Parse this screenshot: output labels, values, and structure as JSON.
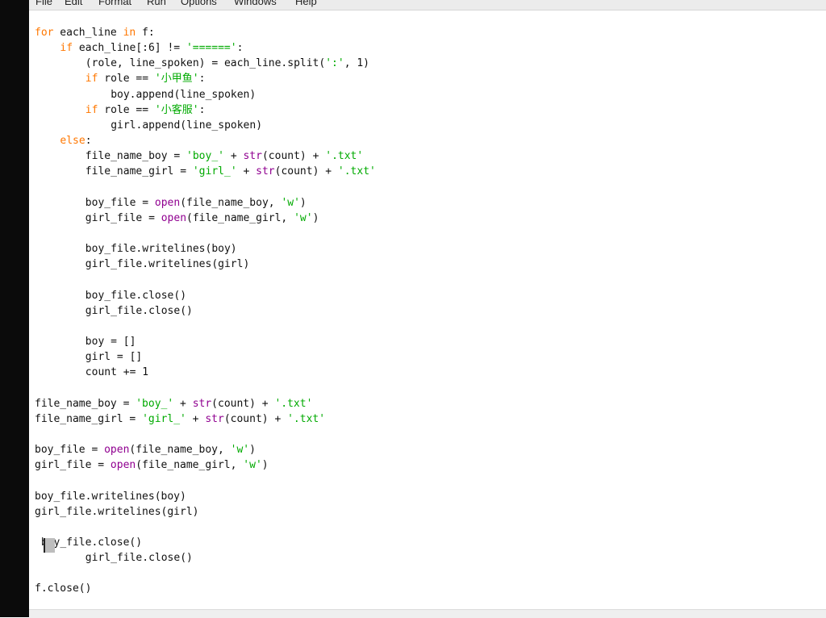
{
  "menubar": {
    "items": [
      "File",
      "Edit",
      "Format",
      "Run",
      "Options",
      "Windows",
      "Help"
    ]
  },
  "editor": {
    "lines": [
      {
        "indent": 0,
        "tokens": [
          {
            "t": "for",
            "c": "kw"
          },
          {
            "t": " each_line "
          },
          {
            "t": "in",
            "c": "kw"
          },
          {
            "t": " f:"
          }
        ]
      },
      {
        "indent": 4,
        "tokens": [
          {
            "t": "if",
            "c": "kw"
          },
          {
            "t": " each_line[:6] != "
          },
          {
            "t": "'======'",
            "c": "str"
          },
          {
            "t": ":"
          }
        ]
      },
      {
        "indent": 8,
        "tokens": [
          {
            "t": "(role, line_spoken) = each_line.split("
          },
          {
            "t": "':'",
            "c": "str"
          },
          {
            "t": ", 1)"
          }
        ]
      },
      {
        "indent": 8,
        "tokens": [
          {
            "t": "if",
            "c": "kw"
          },
          {
            "t": " role == "
          },
          {
            "t": "'小甲鱼'",
            "c": "str"
          },
          {
            "t": ":"
          }
        ]
      },
      {
        "indent": 12,
        "tokens": [
          {
            "t": "boy.append(line_spoken)"
          }
        ]
      },
      {
        "indent": 8,
        "tokens": [
          {
            "t": "if",
            "c": "kw"
          },
          {
            "t": " role == "
          },
          {
            "t": "'小客服'",
            "c": "str"
          },
          {
            "t": ":"
          }
        ]
      },
      {
        "indent": 12,
        "tokens": [
          {
            "t": "girl.append(line_spoken)"
          }
        ]
      },
      {
        "indent": 4,
        "tokens": [
          {
            "t": "else",
            "c": "kw"
          },
          {
            "t": ":"
          }
        ]
      },
      {
        "indent": 8,
        "tokens": [
          {
            "t": "file_name_boy = "
          },
          {
            "t": "'boy_'",
            "c": "str"
          },
          {
            "t": " + "
          },
          {
            "t": "str",
            "c": "bi"
          },
          {
            "t": "(count) + "
          },
          {
            "t": "'.txt'",
            "c": "str"
          }
        ]
      },
      {
        "indent": 8,
        "tokens": [
          {
            "t": "file_name_girl = "
          },
          {
            "t": "'girl_'",
            "c": "str"
          },
          {
            "t": " + "
          },
          {
            "t": "str",
            "c": "bi"
          },
          {
            "t": "(count) + "
          },
          {
            "t": "'.txt'",
            "c": "str"
          }
        ]
      },
      {
        "indent": 0,
        "tokens": []
      },
      {
        "indent": 8,
        "tokens": [
          {
            "t": "boy_file = "
          },
          {
            "t": "open",
            "c": "bi"
          },
          {
            "t": "(file_name_boy, "
          },
          {
            "t": "'w'",
            "c": "str"
          },
          {
            "t": ")"
          }
        ]
      },
      {
        "indent": 8,
        "tokens": [
          {
            "t": "girl_file = "
          },
          {
            "t": "open",
            "c": "bi"
          },
          {
            "t": "(file_name_girl, "
          },
          {
            "t": "'w'",
            "c": "str"
          },
          {
            "t": ")"
          }
        ]
      },
      {
        "indent": 0,
        "tokens": []
      },
      {
        "indent": 8,
        "tokens": [
          {
            "t": "boy_file.writelines(boy)"
          }
        ]
      },
      {
        "indent": 8,
        "tokens": [
          {
            "t": "girl_file.writelines(girl)"
          }
        ]
      },
      {
        "indent": 0,
        "tokens": []
      },
      {
        "indent": 8,
        "tokens": [
          {
            "t": "boy_file.close()"
          }
        ]
      },
      {
        "indent": 8,
        "tokens": [
          {
            "t": "girl_file.close()"
          }
        ]
      },
      {
        "indent": 0,
        "tokens": []
      },
      {
        "indent": 8,
        "tokens": [
          {
            "t": "boy = []"
          }
        ]
      },
      {
        "indent": 8,
        "tokens": [
          {
            "t": "girl = []"
          }
        ]
      },
      {
        "indent": 8,
        "tokens": [
          {
            "t": "count += 1"
          }
        ]
      },
      {
        "indent": 0,
        "tokens": []
      },
      {
        "indent": 0,
        "tokens": [
          {
            "t": "file_name_boy = "
          },
          {
            "t": "'boy_'",
            "c": "str"
          },
          {
            "t": " + "
          },
          {
            "t": "str",
            "c": "bi"
          },
          {
            "t": "(count) + "
          },
          {
            "t": "'.txt'",
            "c": "str"
          }
        ]
      },
      {
        "indent": 0,
        "tokens": [
          {
            "t": "file_name_girl = "
          },
          {
            "t": "'girl_'",
            "c": "str"
          },
          {
            "t": " + "
          },
          {
            "t": "str",
            "c": "bi"
          },
          {
            "t": "(count) + "
          },
          {
            "t": "'.txt'",
            "c": "str"
          }
        ]
      },
      {
        "indent": 0,
        "tokens": []
      },
      {
        "indent": 0,
        "tokens": [
          {
            "t": "boy_file = "
          },
          {
            "t": "open",
            "c": "bi"
          },
          {
            "t": "(file_name_boy, "
          },
          {
            "t": "'w'",
            "c": "str"
          },
          {
            "t": ")"
          }
        ]
      },
      {
        "indent": 0,
        "tokens": [
          {
            "t": "girl_file = "
          },
          {
            "t": "open",
            "c": "bi"
          },
          {
            "t": "(file_name_girl, "
          },
          {
            "t": "'w'",
            "c": "str"
          },
          {
            "t": ")"
          }
        ]
      },
      {
        "indent": 0,
        "tokens": []
      },
      {
        "indent": 0,
        "tokens": [
          {
            "t": "boy_file.writelines(boy)"
          }
        ]
      },
      {
        "indent": 0,
        "tokens": [
          {
            "t": "girl_file.writelines(girl)"
          }
        ]
      },
      {
        "indent": 0,
        "tokens": []
      },
      {
        "indent": 1,
        "tokens": [
          {
            "t": "boy_file.close()"
          }
        ]
      },
      {
        "indent": 8,
        "tokens": [
          {
            "t": "girl_file.close()"
          }
        ]
      },
      {
        "indent": 0,
        "tokens": []
      },
      {
        "indent": 0,
        "tokens": [
          {
            "t": "f.close()"
          }
        ]
      }
    ]
  },
  "colors": {
    "keyword": "#ff7700",
    "builtin": "#900090",
    "string": "#00aa00",
    "text": "#111111"
  }
}
